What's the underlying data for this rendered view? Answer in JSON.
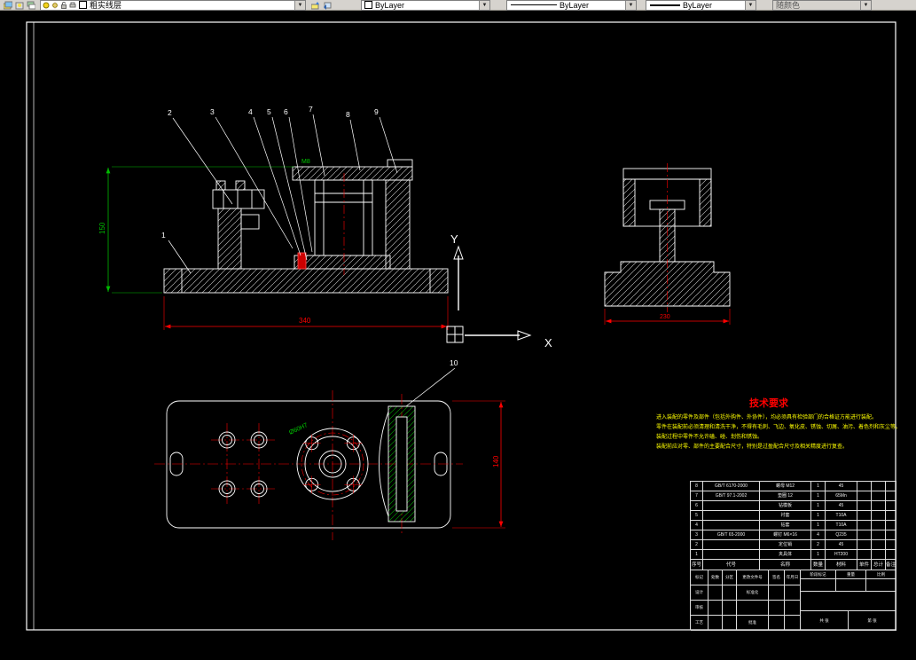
{
  "toolbar": {
    "dropdown_arrow": "▼",
    "layer": "粗实线层",
    "color": "ByLayer",
    "linetype": "ByLayer",
    "lineweight": "ByLayer",
    "plot_style": "随颜色"
  },
  "drawing": {
    "axes": {
      "x_label": "X",
      "y_label": "Y"
    },
    "callouts": {
      "c1": "1",
      "c2": "2",
      "c3": "3",
      "c4": "4",
      "c5": "5",
      "c6": "6",
      "c7": "7",
      "c8": "8",
      "c9": "9",
      "c10": "10"
    },
    "dimensions": {
      "front_width": "340",
      "front_height": "150",
      "side_width": "230",
      "top_height": "140",
      "thread_label": "M8",
      "bore_label": "Ø60H7"
    },
    "tech_req": {
      "title": "技术要求",
      "line1": "进入装配的零件及部件（包括外购件、外协件），均必须具有检验部门的合格证方能进行装配。",
      "line2": "零件在装配前必须清理和清洗干净，不得有毛刺、飞边、氧化皮、锈蚀、切屑、油污、着色剂和灰尘等。",
      "line3": "装配过程中零件不允许磕、碰、划伤和锈蚀。",
      "line4": "装配前应对零、部件的主要配合尺寸，特别是过盈配合尺寸及相关精度进行复查。"
    },
    "bom": {
      "headers": [
        "序号",
        "代号",
        "名称",
        "数量",
        "材料",
        "单件",
        "总计",
        "备注"
      ],
      "rows": [
        [
          "8",
          "GB/T 6170-2000",
          "螺母 M12",
          "1",
          "45",
          "",
          "",
          ""
        ],
        [
          "7",
          "GB/T 97.1-2002",
          "垫圈 12",
          "1",
          "65Mn",
          "",
          "",
          ""
        ],
        [
          "6",
          "",
          "钻模板",
          "1",
          "45",
          "",
          "",
          ""
        ],
        [
          "5",
          "",
          "衬套",
          "1",
          "T10A",
          "",
          "",
          ""
        ],
        [
          "4",
          "",
          "钻套",
          "1",
          "T10A",
          "",
          "",
          ""
        ],
        [
          "3",
          "GB/T 65-2000",
          "螺钉 M6×16",
          "4",
          "Q235",
          "",
          "",
          ""
        ],
        [
          "2",
          "",
          "定位销",
          "2",
          "45",
          "",
          "",
          ""
        ],
        [
          "1",
          "",
          "夹具体",
          "1",
          "HT200",
          "",
          "",
          ""
        ]
      ]
    },
    "title_block": {
      "r1": [
        "标记",
        "处数",
        "分区",
        "更改文件号",
        "签名",
        "年月日"
      ],
      "design": "设计",
      "check": "审核",
      "process": "工艺",
      "standard": "标准化",
      "approve": "批准",
      "stage_mark": "阶段标记",
      "weight": "重量",
      "scale": "比例",
      "sheets": "共 张",
      "sheet_no": "第 张"
    }
  }
}
